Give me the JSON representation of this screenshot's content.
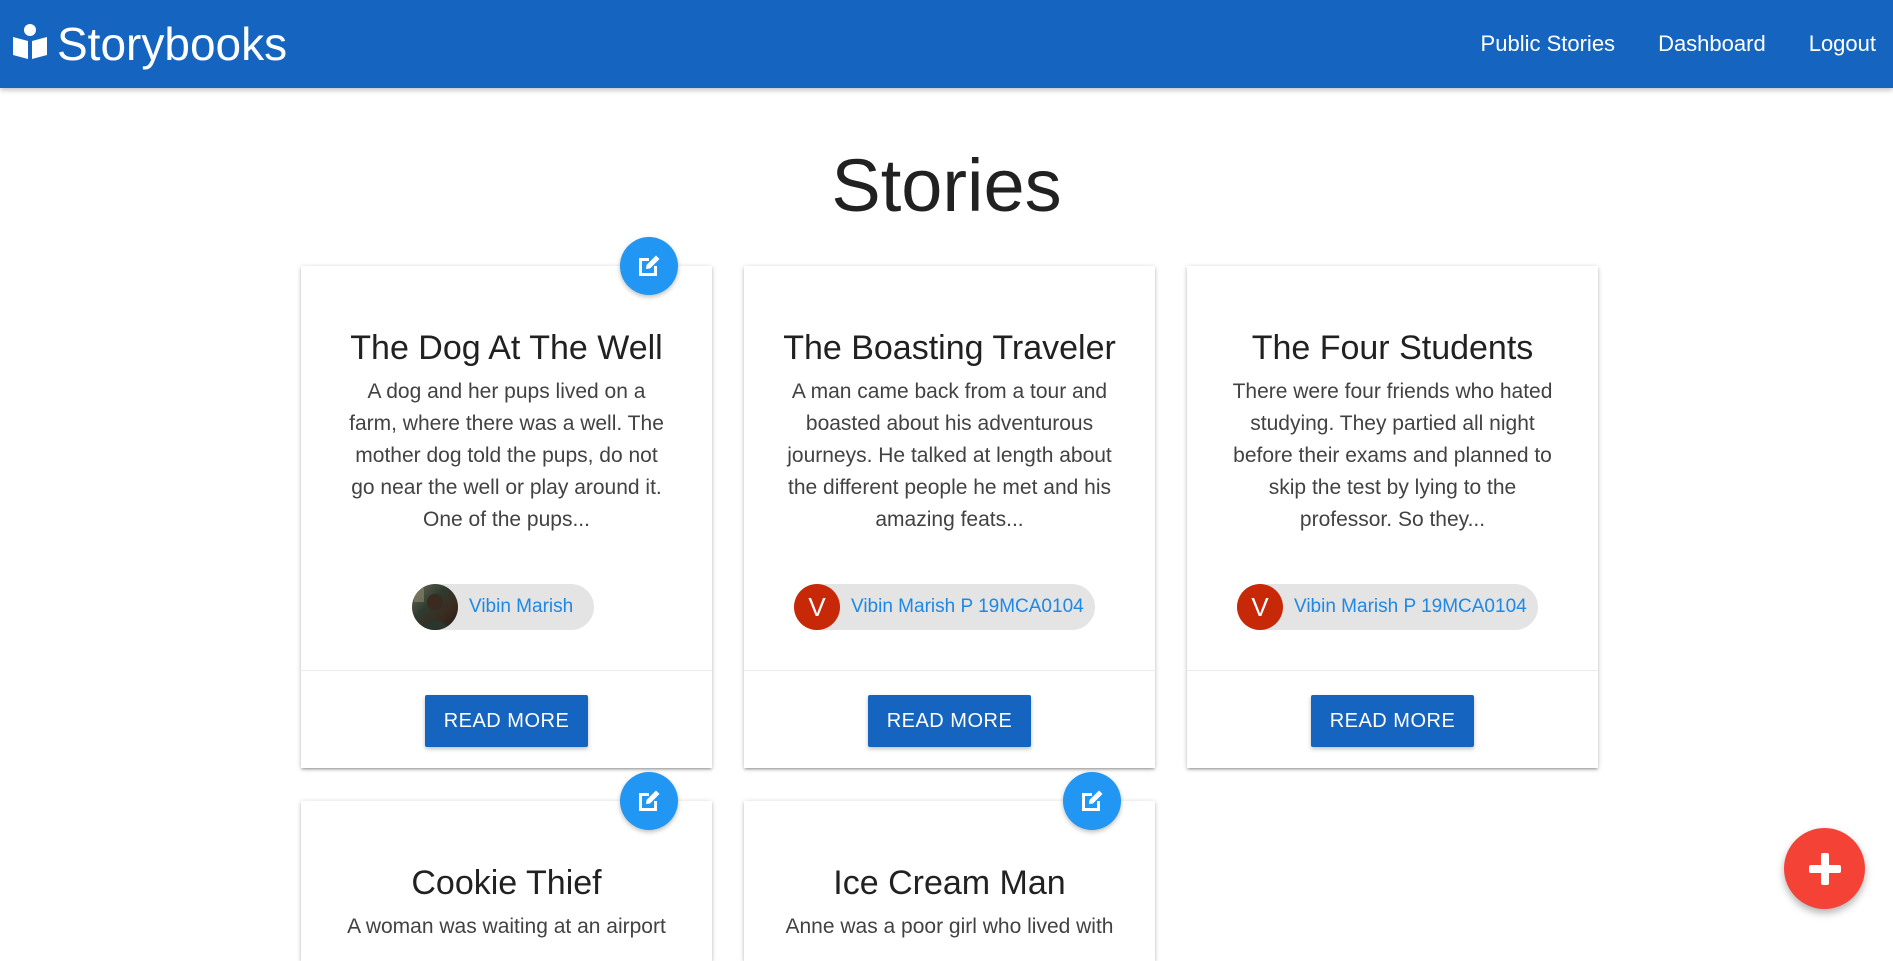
{
  "nav": {
    "brand": "Storybooks",
    "links": [
      "Public Stories",
      "Dashboard",
      "Logout"
    ]
  },
  "page": {
    "title": "Stories"
  },
  "stories": [
    {
      "title": "The Dog At The Well",
      "excerpt": "A dog and her pups lived on a farm, where there was a well. The mother dog told the pups, do not go near the well or play around it. One of the pups...",
      "author": "Vibin Marish",
      "avatar_letter": "",
      "button": "READ MORE"
    },
    {
      "title": "The Boasting Traveler",
      "excerpt": "A man came back from a tour and boasted about his adventurous journeys. He talked at length about the different people he met and his amazing feats...",
      "author": "Vibin Marish P 19MCA0104",
      "avatar_letter": "V",
      "button": "READ MORE"
    },
    {
      "title": "The Four Students",
      "excerpt": "There were four friends who hated studying. They partied all night before their exams and planned to skip the test by lying to the professor. So they...",
      "author": "Vibin Marish P 19MCA0104",
      "avatar_letter": "V",
      "button": "READ MORE"
    },
    {
      "title": "Cookie Thief",
      "excerpt": "A woman was waiting at an airport",
      "author": "",
      "avatar_letter": "",
      "button": ""
    },
    {
      "title": "Ice Cream Man",
      "excerpt": "Anne was a poor girl who lived with",
      "author": "",
      "avatar_letter": "",
      "button": ""
    }
  ],
  "icons": {
    "brand": "book-reader-icon",
    "edit": "edit-icon",
    "add": "plus-icon"
  },
  "colors": {
    "primary": "#1565c0",
    "edit_fab": "#2196f3",
    "add_fab": "#f44336",
    "avatar": "#c62808",
    "author_link": "#1e88e5"
  }
}
